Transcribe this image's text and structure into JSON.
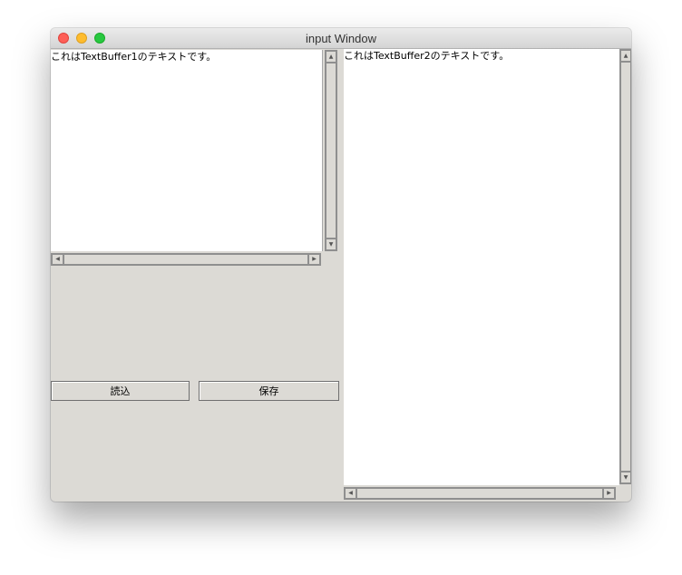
{
  "window": {
    "title": "input Window"
  },
  "text_buffer_1": {
    "content": "これはTextBuffer1のテキストです。"
  },
  "text_buffer_2": {
    "content": "これはTextBuffer2のテキストです。"
  },
  "buttons": {
    "read_label": "読込",
    "save_label": "保存"
  },
  "icons": {
    "close": "close-icon",
    "minimize": "minimize-icon",
    "maximize": "maximize-icon",
    "arrow_up": "▲",
    "arrow_down": "▼",
    "arrow_left": "◀",
    "arrow_right": "▶"
  },
  "colors": {
    "window_bg": "#dcdad5",
    "close": "#fe5f57",
    "minimize": "#febc2e",
    "maximize": "#28c840"
  }
}
